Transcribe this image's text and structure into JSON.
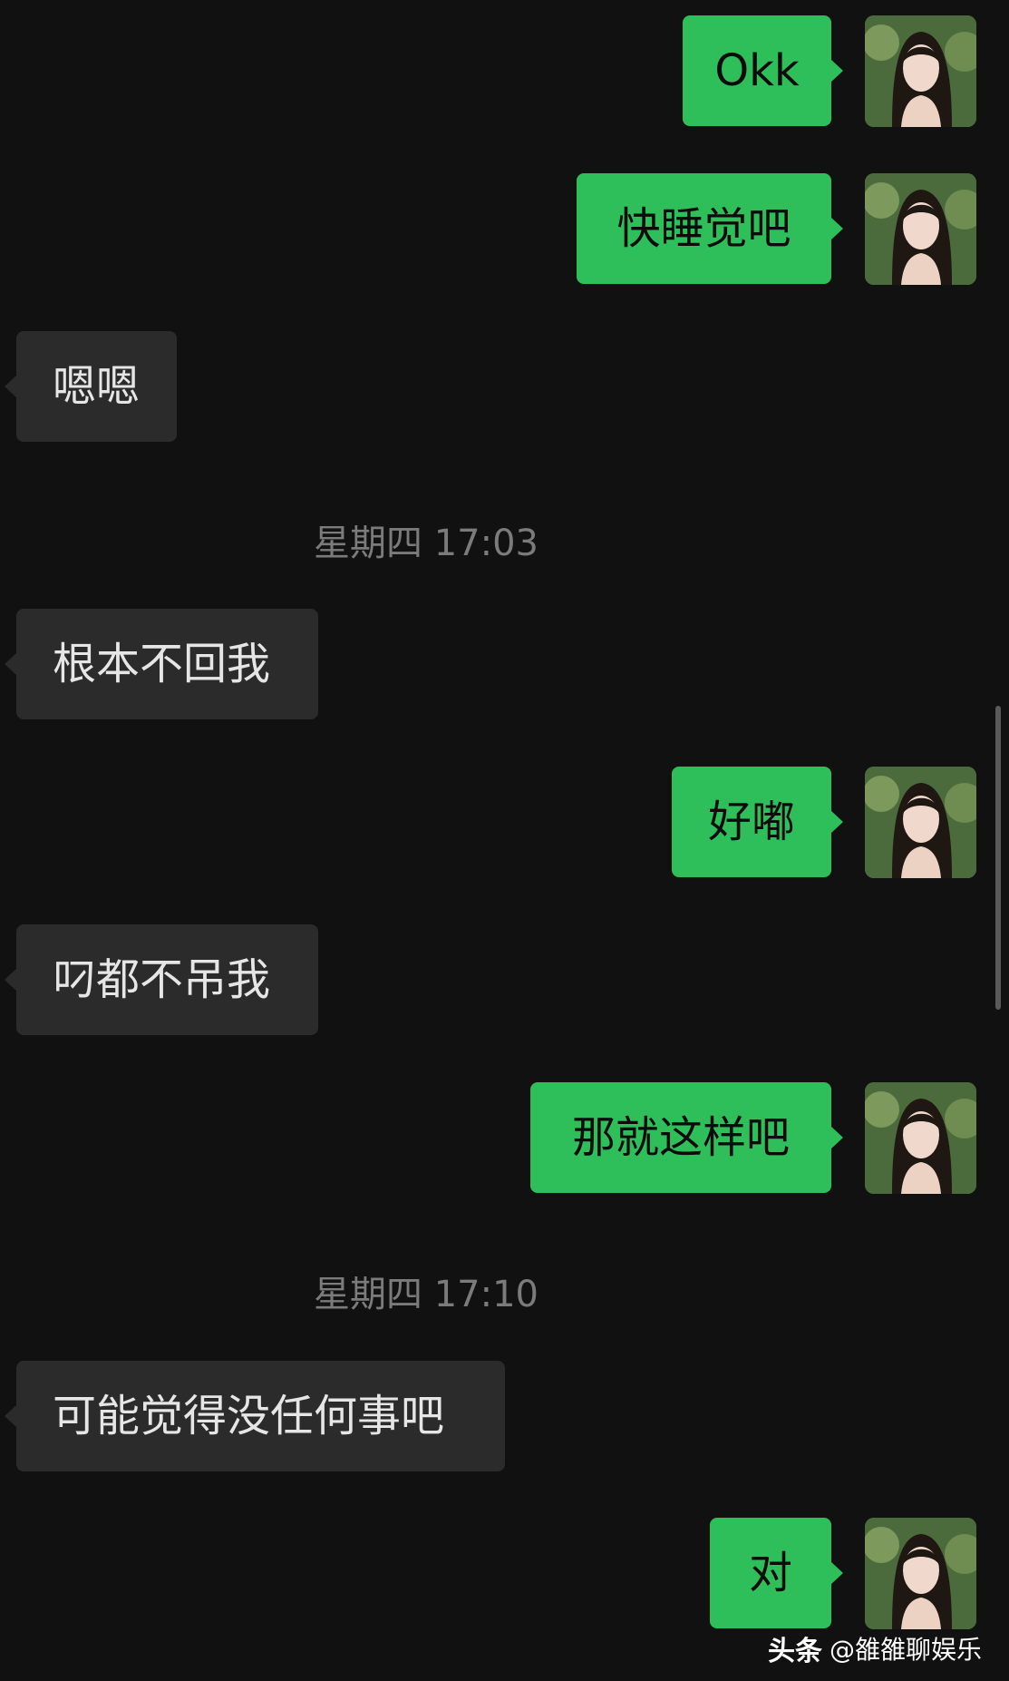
{
  "messages": [
    {
      "side": "out",
      "text": "Okk"
    },
    {
      "side": "out",
      "text": "快睡觉吧"
    },
    {
      "side": "in",
      "text": "嗯嗯"
    },
    {
      "side": "in",
      "text": "根本不回我"
    },
    {
      "side": "out",
      "text": "好嘟"
    },
    {
      "side": "in",
      "text": "叼都不吊我"
    },
    {
      "side": "out",
      "text": "那就这样吧"
    },
    {
      "side": "in",
      "text": "可能觉得没任何事吧"
    },
    {
      "side": "out",
      "text": "对"
    }
  ],
  "timestamps": [
    "星期四 17:03",
    "星期四 17:10"
  ],
  "watermark": {
    "logo": "头条",
    "account": "@雒雒聊娱乐"
  },
  "colors": {
    "background": "#111111",
    "outgoing_bubble": "#2fbf5a",
    "incoming_bubble": "#2b2b2b",
    "timestamp": "#7b7b7b"
  },
  "icons": {
    "avatar": "portrait-avatar-icon"
  }
}
